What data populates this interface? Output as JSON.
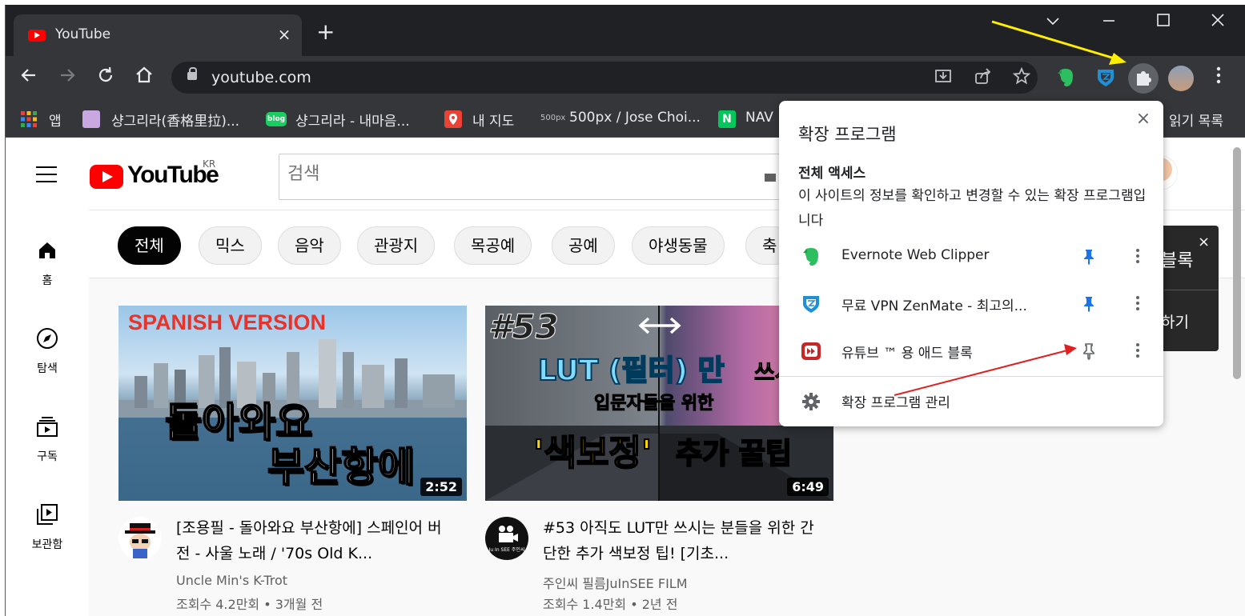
{
  "browser": {
    "tab_title": "YouTube",
    "tab_close": "×",
    "new_tab": "+",
    "url": "youtube.com",
    "bookmarks": [
      {
        "label": "앱"
      },
      {
        "label": "샹그리라(香格里拉)..."
      },
      {
        "label": "샹그리라 - 내마음..."
      },
      {
        "label": "내 지도"
      },
      {
        "label": "500px / Jose Choi..."
      },
      {
        "label": "NAV"
      },
      {
        "label": "읽기 목록"
      }
    ],
    "icons": {
      "blog": "blog",
      "fivehundred": "500px",
      "naver": "N"
    }
  },
  "youtube": {
    "logo_text": "YouTube",
    "region": "KR",
    "search_placeholder": "검색",
    "nav": [
      {
        "label": "홈"
      },
      {
        "label": "탐색"
      },
      {
        "label": "구독"
      },
      {
        "label": "보관함"
      }
    ],
    "chips": [
      "전체",
      "믹스",
      "음악",
      "관광지",
      "목공예",
      "공예",
      "야생동물",
      "축"
    ],
    "videos": [
      {
        "title": "[조용필 - 돌아와요 부산항에] 스페인어 버전 - 사울 노래 / '70s Old K...",
        "channel": "Uncle Min's K-Trot",
        "meta": "조회수 4.2만회 • 3개월 전",
        "duration": "2:52",
        "thumb_banner": "SPANISH VERSION",
        "thumb_line1": "돌아와요",
        "thumb_line2": "부산항에"
      },
      {
        "title": "#53 아직도 LUT만 쓰시는 분들을 위한 간단한 추가 색보정 팁! [기초...",
        "channel": "주인씨 필름JuInSEE FILM",
        "meta": "조회수 1.4만회 • 2년 전",
        "duration": "6:49",
        "thumb_num": "#53",
        "thumb_line1": "LUT (필터) 만",
        "thumb_line1b": "쓰시는",
        "thumb_line2": "입문자들을 위한",
        "thumb_line3a": "'색보정'",
        "thumb_line3b": "추가 꿀팁",
        "avatar_text": "Ju In SEE 주인씨"
      }
    ],
    "toast": {
      "line1": "블록",
      "line2": "하기",
      "close": "×"
    }
  },
  "popup": {
    "title": "확장 프로그램",
    "close": "×",
    "section_title": "전체 액세스",
    "section_desc": "이 사이트의 정보를 확인하고 변경할 수 있는 확장 프로그램입니다",
    "extensions": [
      {
        "name": "Evernote Web Clipper",
        "pinned": true
      },
      {
        "name": "무료 VPN ZenMate - 최고의...",
        "pinned": true
      },
      {
        "name": "유튜브 ™ 용 애드 블록",
        "pinned": false
      }
    ],
    "manage_label": "확장 프로그램 관리"
  },
  "colors": {
    "pin_active": "#1a73e8",
    "pin_inactive": "#5f6368",
    "arrow_yellow": "#ffee00",
    "arrow_red": "#e02020"
  }
}
